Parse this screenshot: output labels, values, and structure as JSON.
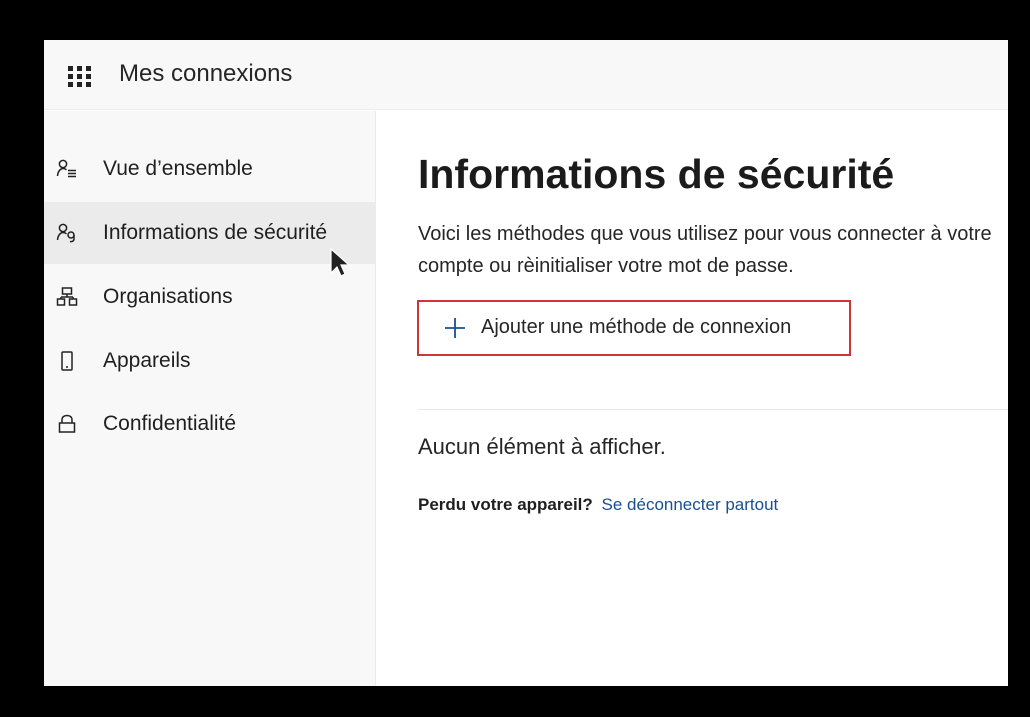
{
  "header": {
    "title": "Mes connexions",
    "waffle_icon": "app-launcher-icon"
  },
  "sidebar": {
    "items": [
      {
        "label": "Vue d’ensemble",
        "icon": "person-list-icon",
        "active": false
      },
      {
        "label": "Informations de sécurité",
        "icon": "person-key-icon",
        "active": true
      },
      {
        "label": "Organisations",
        "icon": "org-chart-icon",
        "active": false
      },
      {
        "label": "Appareils",
        "icon": "phone-icon",
        "active": false
      },
      {
        "label": "Confidentialité",
        "icon": "lock-icon",
        "active": false
      }
    ]
  },
  "main": {
    "title": "Informations de sécurité",
    "description": "Voici les méthodes que vous utilisez pour vous connecter à votre compte ou rèinitialiser votre mot de passe.",
    "add_button_label": "Ajouter une méthode de connexion",
    "empty_text": "Aucun élément à afficher.",
    "lost_device_question": "Perdu votre appareil?",
    "sign_out_link": "Se déconnecter partout"
  },
  "colors": {
    "accent": "#1a4f8f",
    "highlight_border": "#d13438",
    "plus_icon": "#1a4f8f",
    "sidebar_bg": "#f8f8f8",
    "active_item_bg": "#ebebeb"
  }
}
